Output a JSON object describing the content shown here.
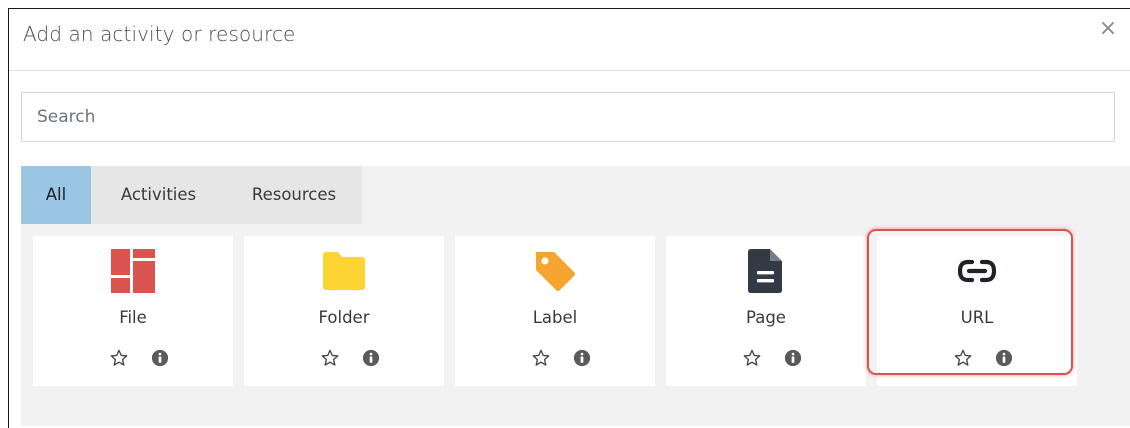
{
  "dialog": {
    "title": "Add an activity or resource",
    "close_glyph": "×"
  },
  "search": {
    "placeholder": "Search",
    "value": ""
  },
  "tabs": [
    {
      "label": "All",
      "active": true
    },
    {
      "label": "Activities",
      "active": false
    },
    {
      "label": "Resources",
      "active": false
    }
  ],
  "modules": [
    {
      "label": "File",
      "icon": "file-icon",
      "color": "#d9534f"
    },
    {
      "label": "Folder",
      "icon": "folder-icon",
      "color": "#fcd433"
    },
    {
      "label": "Label",
      "icon": "tag-icon",
      "color": "#f5a430"
    },
    {
      "label": "Page",
      "icon": "document-icon",
      "color": "#323a45"
    },
    {
      "label": "URL",
      "icon": "link-icon",
      "color": "#1f2329",
      "highlighted": true
    }
  ],
  "colors": {
    "active_tab": "#9bc6e3",
    "highlight": "#d9534f"
  }
}
